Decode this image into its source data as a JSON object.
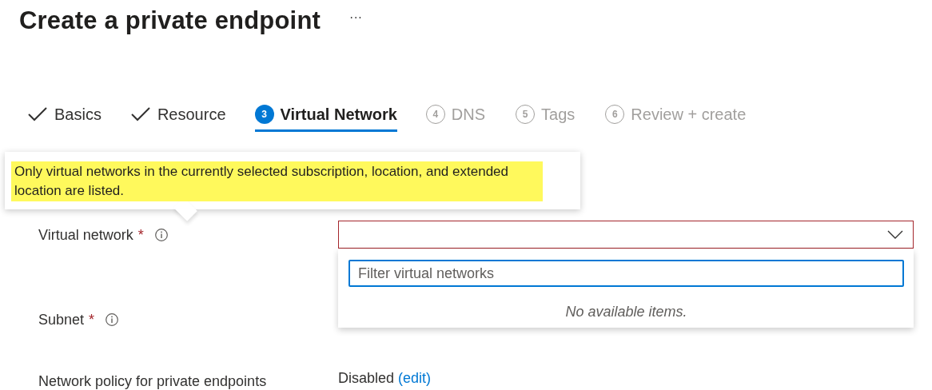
{
  "page": {
    "title": "Create a private endpoint",
    "more": "···"
  },
  "steps": [
    {
      "kind": "done",
      "label": "Basics",
      "selected": false
    },
    {
      "kind": "done",
      "label": "Resource",
      "selected": false
    },
    {
      "kind": "current",
      "number": "3",
      "label": "Virtual Network",
      "selected": true
    },
    {
      "kind": "pending",
      "number": "4",
      "label": "DNS",
      "selected": false
    },
    {
      "kind": "pending",
      "number": "5",
      "label": "Tags",
      "selected": false
    },
    {
      "kind": "pending",
      "number": "6",
      "label": "Review + create",
      "selected": false
    }
  ],
  "tooltip": {
    "text": "Only virtual networks in the currently selected subscription, location, and extended location are listed."
  },
  "fields": [
    {
      "label": "Virtual network",
      "required_mark": "*",
      "info": true
    },
    {
      "label": "Subnet",
      "required_mark": "*",
      "info": true
    },
    {
      "label": "Network policy for private endpoints",
      "value": "Disabled",
      "link": "(edit)"
    }
  ],
  "dropdown": {
    "expanded": true,
    "invalid": true,
    "filter_placeholder": "Filter virtual networks",
    "empty_message": "No available items."
  }
}
